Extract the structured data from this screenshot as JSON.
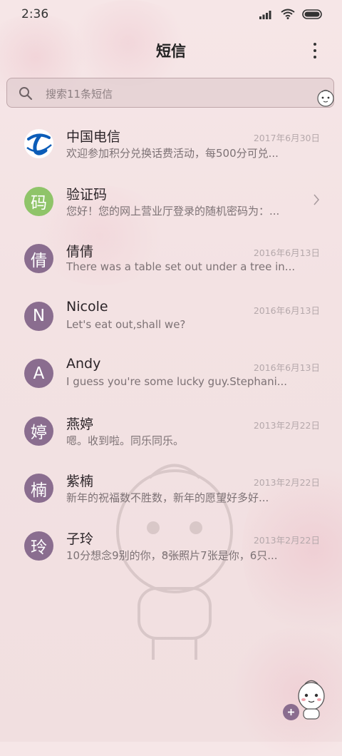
{
  "status": {
    "time": "2:36"
  },
  "header": {
    "title": "短信"
  },
  "search": {
    "placeholder": "搜索11条短信"
  },
  "messages": [
    {
      "name": "中国电信",
      "date": "2017年6月30日",
      "preview": "欢迎参加积分兑换话费活动，每500分可兑...",
      "avatar": "",
      "avatar_type": "logo"
    },
    {
      "name": "验证码",
      "date": "",
      "preview": "您好！您的网上营业厅登录的随机密码为：...",
      "avatar": "码",
      "avatar_type": "green"
    },
    {
      "name": "倩倩",
      "date": "2016年6月13日",
      "preview": "There was a table set out under a tree in...",
      "avatar": "倩",
      "avatar_type": "purple"
    },
    {
      "name": "Nicole",
      "date": "2016年6月13日",
      "preview": "Let's eat out,shall we?",
      "avatar": "N",
      "avatar_type": "purple"
    },
    {
      "name": "Andy",
      "date": "2016年6月13日",
      "preview": "I guess you're some lucky guy.Stephani...",
      "avatar": "A",
      "avatar_type": "purple"
    },
    {
      "name": "燕婷",
      "date": "2013年2月22日",
      "preview": "嗯。收到啦。同乐同乐。",
      "avatar": "婷",
      "avatar_type": "purple"
    },
    {
      "name": "紫楠",
      "date": "2013年2月22日",
      "preview": "新年的祝福数不胜数，新年的愿望好多好...",
      "avatar": "楠",
      "avatar_type": "purple"
    },
    {
      "name": "子玲",
      "date": "2013年2月22日",
      "preview": "10分想念9别的你，8张照片7张是你，6只...",
      "avatar": "玲",
      "avatar_type": "purple"
    }
  ],
  "icons": {
    "signal": "signal-icon",
    "wifi": "wifi-icon",
    "battery": "battery-icon",
    "menu": "more-vertical-icon",
    "search": "search-icon",
    "chevron": "chevron-right-icon",
    "compose": "plus-icon"
  },
  "colors": {
    "avatar_purple": "#8a6d8f",
    "avatar_green": "#8fc469",
    "background": "#f3e2e3"
  }
}
